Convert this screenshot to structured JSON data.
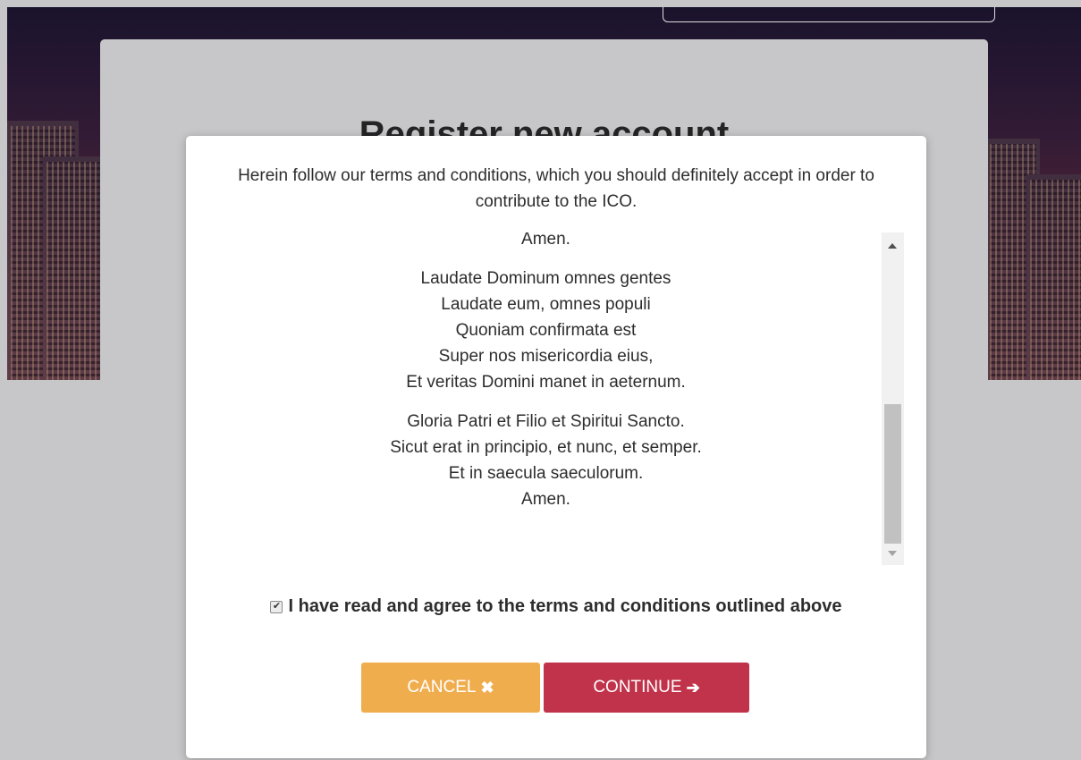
{
  "page": {
    "register_title": "Register new account"
  },
  "modal": {
    "intro": "Herein follow our terms and conditions, which you should definitely accept in order to contribute to the ICO.",
    "terms_paragraphs": [
      [
        "Amen."
      ],
      [
        "Laudate Dominum omnes gentes",
        "Laudate eum, omnes populi",
        "Quoniam confirmata est",
        "Super nos misericordia eius,",
        "Et veritas Domini manet in aeternum."
      ],
      [
        "Gloria Patri et Filio et Spiritui Sancto.",
        "Sicut erat in principio, et nunc, et semper.",
        "Et in saecula saeculorum.",
        "Amen."
      ]
    ],
    "agree_checked": true,
    "agree_label": "I have read and agree to the terms and conditions outlined above",
    "checkbox_icon": "check-icon",
    "cancel_label": "CANCEL",
    "cancel_icon": "close-icon",
    "continue_label": "CONTINUE",
    "continue_icon": "arrow-right-icon"
  },
  "colors": {
    "cancel": "#f0ad4e",
    "continue": "#c0334a",
    "overlay": "#c7c7c9"
  }
}
